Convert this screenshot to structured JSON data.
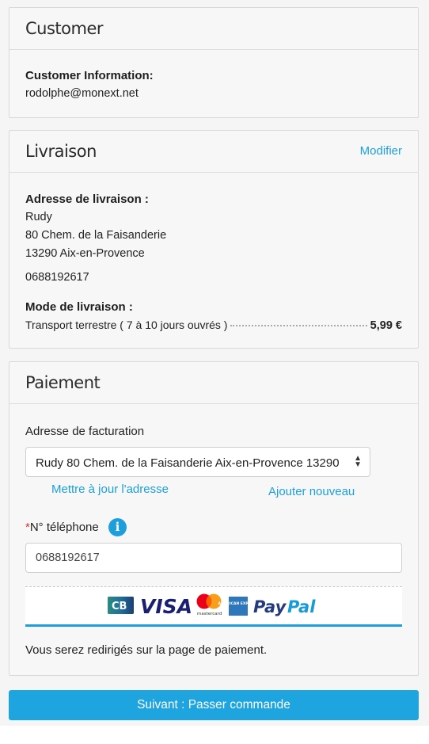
{
  "customer": {
    "title": "Customer",
    "info_label": "Customer Information:",
    "email": "rodolphe@monext.net"
  },
  "livraison": {
    "title": "Livraison",
    "modify_link": "Modifier",
    "address_label": "Adresse de livraison :",
    "name": "Rudy",
    "street": "80 Chem. de la Faisanderie",
    "city": "13290 Aix-en-Provence",
    "phone": "0688192617",
    "mode_label": "Mode de livraison :",
    "mode_text": "Transport terrestre ( 7 à 10 jours ouvrés )",
    "mode_price": "5,99 €"
  },
  "paiement": {
    "title": "Paiement",
    "billing_label": "Adresse de facturation",
    "billing_value": "Rudy 80 Chem. de la Faisanderie Aix-en-Provence 13290",
    "update_link": "Mettre à jour l'adresse",
    "add_link": "Ajouter nouveau",
    "phone_required_mark": "*",
    "phone_label": "N° téléphone",
    "info_icon": "i",
    "phone_value": "0688192617",
    "logos": [
      "cb-logo",
      "visa-logo",
      "mastercard-logo",
      "amex-logo",
      "paypal-logo"
    ],
    "logo_texts": {
      "visa": "VISA",
      "mastercard": "mastercard",
      "amex": "AMERICAN EXPRESS",
      "paypal_pay": "Pay",
      "paypal_pal": "Pal"
    },
    "redirect_text": "Vous serez redirigés sur la page de paiement."
  },
  "submit_label": "Suivant : Passer commande",
  "colors": {
    "accent": "#1e9fdc",
    "button": "#1ea5e0",
    "required": "#d9342b"
  }
}
